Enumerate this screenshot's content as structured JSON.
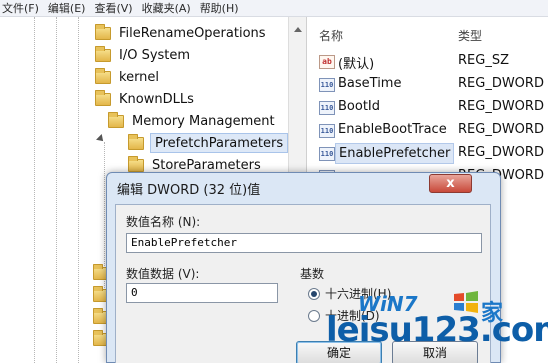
{
  "menu": [
    "文件(F)",
    "编辑(E)",
    "查看(V)",
    "收藏夹(A)",
    "帮助(H)"
  ],
  "tree": {
    "items": [
      {
        "label": "FileRenameOperations"
      },
      {
        "label": "I/O System"
      },
      {
        "label": "kernel"
      },
      {
        "label": "KnownDLLs"
      },
      {
        "label": "Memory Management"
      },
      {
        "label": "PrefetchParameters"
      },
      {
        "label": "StoreParameters"
      }
    ]
  },
  "list": {
    "headers": {
      "name": "名称",
      "type": "类型"
    },
    "rows": [
      {
        "icon": "ab",
        "name": "(默认)",
        "type": "REG_SZ"
      },
      {
        "icon": "110",
        "name": "BaseTime",
        "type": "REG_DWORD"
      },
      {
        "icon": "110",
        "name": "BootId",
        "type": "REG_DWORD"
      },
      {
        "icon": "110",
        "name": "EnableBootTrace",
        "type": "REG_DWORD"
      },
      {
        "icon": "110",
        "name": "EnablePrefetcher",
        "type": "REG_DWORD"
      },
      {
        "icon": "110",
        "name": "",
        "type": "REG_DWORD"
      }
    ]
  },
  "dialog": {
    "title": "编辑 DWORD (32 位)值",
    "close_label": "x",
    "name_label": "数值名称 (N):",
    "name_value": "EnablePrefetcher",
    "data_label": "数值数据 (V):",
    "data_value": "0",
    "base_label": "基数",
    "radio_hex": "十六进制(H)",
    "radio_dec": "十进制(D)",
    "ok_label": "确定",
    "cancel_label": "取消"
  },
  "watermark": {
    "line1": "WiN7",
    "line2": "leisu123.com",
    "line3": "家"
  }
}
